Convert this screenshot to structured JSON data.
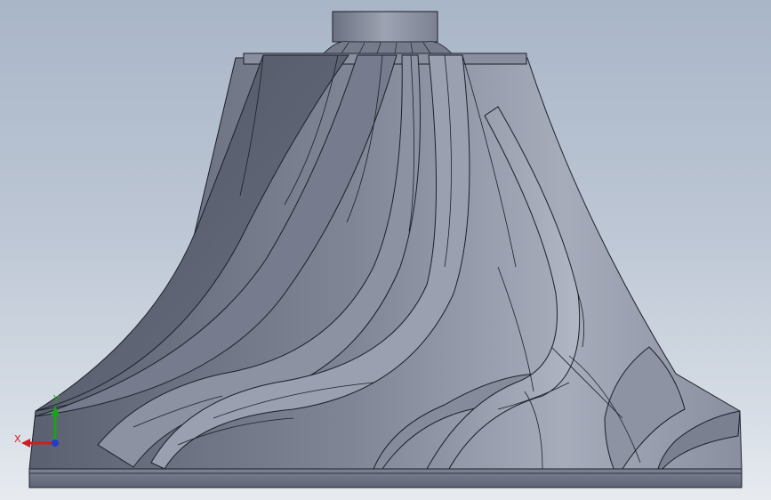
{
  "viewport": {
    "background_top": "#a9b6c8",
    "background_bottom": "#e7ebf0",
    "model_color": "#7b8191",
    "edge_color": "#1b1f27"
  },
  "triad": {
    "x_label": "X",
    "y_label": "Y",
    "x_color": "#cc1f1f",
    "y_color": "#19a319",
    "z_color": "#1f3ccc"
  }
}
